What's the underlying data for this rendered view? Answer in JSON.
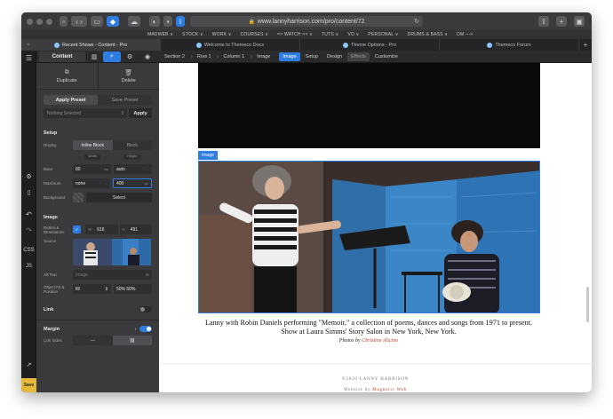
{
  "browser": {
    "url": "www.lannyharrison.com/pro/content/72",
    "bookmarks": [
      "MADWEB ∨",
      "STOCK ∨",
      "WORK ∨",
      "COURSES ∨",
      "=> WATCH << ∨",
      "TUTS ∨",
      "VO ∨",
      "PERSONAL ∨",
      "DRUMS & BASS ∨",
      "DM --->"
    ],
    "tabs": [
      {
        "label": "Recent Shows - Content - Pro",
        "active": true
      },
      {
        "label": "Welcome to Themeco Docs",
        "active": false
      },
      {
        "label": "Theme Options - Pro",
        "active": false
      },
      {
        "label": "Themeco Forum",
        "active": false
      }
    ]
  },
  "rail": {
    "css_label": "CSS",
    "js_label": "JS",
    "save_label": "Save"
  },
  "panel": {
    "content_tab": "Content",
    "duplicate": "Duplicate",
    "delete": "Delete",
    "apply_preset": "Apply Preset",
    "save_preset": "Save Preset",
    "preset_placeholder": "Nothing Selected",
    "apply": "Apply",
    "setup": {
      "title": "Setup",
      "display_label": "Display",
      "display_options": [
        "Inline Block",
        "Block"
      ],
      "width_label": "Width",
      "height_label": "Height",
      "base_label": "Base",
      "base_width": "80",
      "base_width_unit": "vw",
      "base_height": "auto",
      "base_height_unit": "...",
      "maximum_label": "Maximum",
      "max_width": "none",
      "max_width_unit": "...",
      "max_height": "400",
      "max_height_unit": "px",
      "background_label": "Background",
      "select": "Select"
    },
    "image": {
      "title": "Image",
      "retina_label": "Retina & Dimensions",
      "w_key": "W",
      "w_val": "616",
      "h_key": "H",
      "h_val": "491",
      "source_label": "Source",
      "alt_label": "Alt Text",
      "alt_placeholder": "Image",
      "fit_label": "Object Fit & Position",
      "fit_val": "fill",
      "position_val": "50% 50%"
    },
    "link_title": "Link",
    "margin_title": "Margin",
    "link_sides_label": "Link Sides"
  },
  "breadcrumbs": [
    "Section 2",
    "Row 1",
    "Column 1",
    "Image"
  ],
  "control_tabs": [
    "Image",
    "Setup",
    "Design",
    "Effects",
    "Customize"
  ],
  "canvas": {
    "image_tag": "Image",
    "caption_line1": "Lanny with Robin Daniels performing \"Memoir,\" a collection of poems, dances and songs from 1971 to present.",
    "caption_line2": "Show at Laura Simms' Story Salon in New York, New York.",
    "credit_prefix": "Photos by",
    "credit_name": "Christine Alicino",
    "copyright": "©2020 LANNY HARRISON",
    "website_prefix": "Website by",
    "website_name": "Magnetic Web"
  },
  "colors": {
    "accent": "#2f7de1",
    "save": "#e6b83a",
    "link_red": "#c0392b",
    "panel_bg": "#3a3a3d"
  }
}
